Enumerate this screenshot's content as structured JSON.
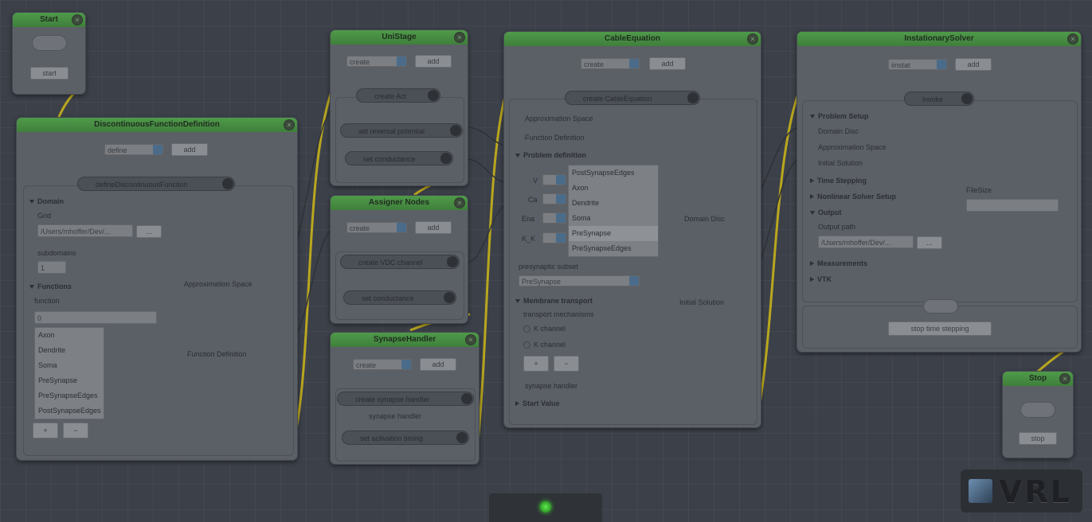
{
  "start_node": {
    "title": "Start",
    "button": "start"
  },
  "stop_node": {
    "title": "Stop",
    "button": "stop"
  },
  "common": {
    "select_value": "create",
    "add": "add",
    "plus": "+",
    "minus": "−"
  },
  "disc_func": {
    "title": "DiscontinuousFunctionDefinition",
    "select_value": "define",
    "method": "defineDiscontinuousFunction",
    "domain_label": "Domain",
    "grid_label": "Grid",
    "grid_path": "/Users/mhoffer/Dev/...",
    "browse": "...",
    "subdomains_label": "subdomains",
    "subdomains_value": "1",
    "functions_label": "Functions",
    "function_label": "function",
    "function_value": "0",
    "list": [
      "Axon",
      "Dendrite",
      "Soma",
      "PreSynapse",
      "PreSynapseEdges",
      "PostSynapseEdges"
    ],
    "out_approx": "Approximation Space",
    "out_func": "Function Definition"
  },
  "unistage": {
    "title": "UniStage",
    "method1": "create Act",
    "method2": "set reversal potential",
    "method3": "set conductance"
  },
  "assigner": {
    "title": "Assigner Nodes",
    "method1": "create VDC channel",
    "method2": "set conductance"
  },
  "synapse": {
    "title": "SynapseHandler",
    "method1": "create synapse handler",
    "handler_label": "synapse handler",
    "method2": "set activation timing"
  },
  "cable": {
    "title": "CableEquation",
    "method": "create CableEquation",
    "approx_label": "Approximation Space",
    "funcdef_label": "Function Definition",
    "problem_label": "Problem definition",
    "rows": [
      {
        "label": "V"
      },
      {
        "label": "Ca"
      },
      {
        "label": "Ena"
      },
      {
        "label": "K_K"
      }
    ],
    "list": [
      "PostSynapseEdges",
      "Axon",
      "Dendrite",
      "Soma",
      "PreSynapse",
      "PreSynapseEdges"
    ],
    "domain_disc": "Domain Disc",
    "presynaptic_label": "presynaptic subset",
    "presynaptic_value": "PreSynapse",
    "membrane_label": "Membrane transport",
    "transport_label": "transport mechanisms",
    "radio1": "K channel",
    "radio2": "K channel",
    "initial_solution": "Initial Solution",
    "synapse_handler": "synapse handler",
    "start_value": "Start Value"
  },
  "instationary": {
    "title": "InstationarySolver",
    "select_value": "iinstat",
    "method": "invoke",
    "problem_setup": "Problem Setup",
    "domain_disc": "Domain Disc",
    "approx_space": "Approximation Space",
    "initial_solution": "Initial Solution",
    "time_stepping": "Time Stepping",
    "nonlinear": "Nonlinear Solver Setup",
    "output": "Output",
    "output_path": "Output path",
    "path_value": "/Users/mhoffer/Dev/...",
    "browse": "...",
    "measurements": "Measurements",
    "vtk": "VTK",
    "file_size_label": "FileSize",
    "stop_button": "stop time stepping"
  },
  "vrl_logo": "VRL"
}
